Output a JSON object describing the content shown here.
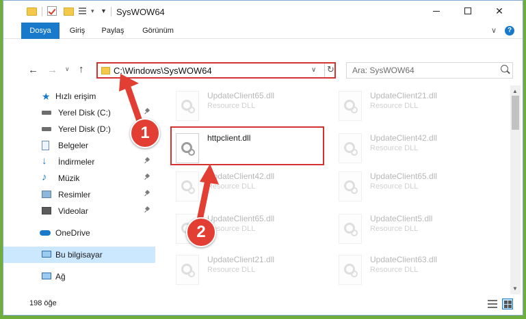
{
  "window": {
    "title": "SysWOW64",
    "controls": {
      "minimize": "—",
      "maximize": "□",
      "close": "✕"
    }
  },
  "ribbon": {
    "tabs": [
      {
        "label": "Dosya"
      },
      {
        "label": "Giriş"
      },
      {
        "label": "Paylaş"
      },
      {
        "label": "Görünüm"
      }
    ],
    "help": "?"
  },
  "navigation": {
    "address": "C:\\Windows\\SysWOW64",
    "search_placeholder": "Ara: SysWOW64"
  },
  "sidebar": {
    "items": [
      {
        "label": "Hızlı erişim"
      },
      {
        "label": "Yerel Disk (C:)"
      },
      {
        "label": "Yerel Disk (D:)"
      },
      {
        "label": "Belgeler"
      },
      {
        "label": "İndirmeler"
      },
      {
        "label": "Müzik"
      },
      {
        "label": "Resimler"
      },
      {
        "label": "Videolar"
      },
      {
        "label": "OneDrive"
      },
      {
        "label": "Bu bilgisayar"
      },
      {
        "label": "Ağ"
      }
    ]
  },
  "files": [
    {
      "name": "UpdateClient65.dll",
      "type": "Resource DLL"
    },
    {
      "name": "UpdateClient21.dll",
      "type": "Resource DLL"
    },
    {
      "name": "httpclient.dll",
      "type": ""
    },
    {
      "name": "UpdateClient42.dll",
      "type": "Resource DLL"
    },
    {
      "name": "UpdateClient42.dll",
      "type": "Resource DLL"
    },
    {
      "name": "UpdateClient65.dll",
      "type": "Resource DLL"
    },
    {
      "name": "UpdateClient65.dll",
      "type": "Resource DLL"
    },
    {
      "name": "UpdateClient5.dll",
      "type": "Resource DLL"
    },
    {
      "name": "UpdateClient21.dll",
      "type": "Resource DLL"
    },
    {
      "name": "UpdateClient63.dll",
      "type": "Resource DLL"
    }
  ],
  "status": {
    "item_count": "198 öğe"
  },
  "annotations": {
    "step1": "1",
    "step2": "2",
    "color": "#e23e33"
  },
  "colors": {
    "accent": "#1979ca",
    "highlight_border": "#d5322f",
    "selection": "#cce8ff"
  }
}
